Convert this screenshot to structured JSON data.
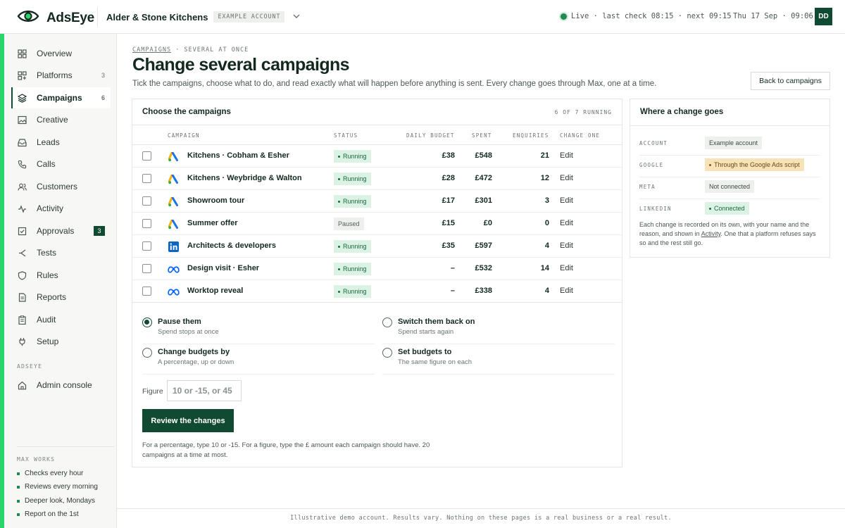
{
  "header": {
    "brand": "AdsEye",
    "account_name": "Alder & Stone Kitchens",
    "account_tag": "EXAMPLE ACCOUNT",
    "live_status": "Live · last check 08:15 · next 09:15",
    "datetime": "Thu 17 Sep · 09:06",
    "avatar_initials": "DD"
  },
  "sidebar": {
    "items": [
      {
        "label": "Overview",
        "icon": "grid-icon",
        "count": ""
      },
      {
        "label": "Platforms",
        "icon": "platforms-icon",
        "count": "3"
      },
      {
        "label": "Campaigns",
        "icon": "layers-icon",
        "count": "6",
        "active": true
      },
      {
        "label": "Creative",
        "icon": "image-icon",
        "count": ""
      },
      {
        "label": "Leads",
        "icon": "inbox-icon",
        "count": ""
      },
      {
        "label": "Calls",
        "icon": "phone-icon",
        "count": ""
      },
      {
        "label": "Customers",
        "icon": "users-icon",
        "count": ""
      },
      {
        "label": "Activity",
        "icon": "activity-icon",
        "count": ""
      },
      {
        "label": "Approvals",
        "icon": "checkbox-icon",
        "count": "3"
      },
      {
        "label": "Tests",
        "icon": "split-icon",
        "count": ""
      },
      {
        "label": "Rules",
        "icon": "shield-icon",
        "count": ""
      },
      {
        "label": "Reports",
        "icon": "document-icon",
        "count": ""
      },
      {
        "label": "Audit",
        "icon": "clipboard-icon",
        "count": ""
      },
      {
        "label": "Setup",
        "icon": "plug-icon",
        "count": ""
      }
    ],
    "section_label": "ADSEYE",
    "admin_label": "Admin console",
    "works_label": "MAX WORKS",
    "works": [
      "Checks every hour",
      "Reviews every morning",
      "Deeper look, Mondays",
      "Report on the 1st"
    ]
  },
  "page": {
    "breadcrumb_link": "CAMPAIGNS",
    "breadcrumb_rest": "· SEVERAL AT ONCE",
    "title": "Change several campaigns",
    "subtitle": "Tick the campaigns, choose what to do, and read exactly what will happen before anything is sent. Every change goes through Max, one at a time.",
    "back_button": "Back to campaigns"
  },
  "campaigns_panel": {
    "title": "Choose the campaigns",
    "meta": "6 OF 7 RUNNING",
    "columns": [
      "CAMPAIGN",
      "STATUS",
      "DAILY BUDGET",
      "SPENT",
      "ENQUIRIES",
      "CHANGE ONE"
    ],
    "rows": [
      {
        "platform": "google",
        "name": "Kitchens · Cobham & Esher",
        "status": "Running",
        "running": true,
        "budget": "£38",
        "spent": "£548",
        "enquiries": "21",
        "action": "Edit"
      },
      {
        "platform": "google",
        "name": "Kitchens · Weybridge & Walton",
        "status": "Running",
        "running": true,
        "budget": "£28",
        "spent": "£472",
        "enquiries": "12",
        "action": "Edit"
      },
      {
        "platform": "google",
        "name": "Showroom tour",
        "status": "Running",
        "running": true,
        "budget": "£17",
        "spent": "£301",
        "enquiries": "3",
        "action": "Edit"
      },
      {
        "platform": "google",
        "name": "Summer offer",
        "status": "Paused",
        "running": false,
        "budget": "£15",
        "spent": "£0",
        "enquiries": "0",
        "action": "Edit"
      },
      {
        "platform": "linkedin",
        "name": "Architects & developers",
        "status": "Running",
        "running": true,
        "budget": "£35",
        "spent": "£597",
        "enquiries": "4",
        "action": "Edit"
      },
      {
        "platform": "meta",
        "name": "Design visit · Esher",
        "status": "Running",
        "running": true,
        "budget": "–",
        "spent": "£532",
        "enquiries": "14",
        "action": "Edit"
      },
      {
        "platform": "meta",
        "name": "Worktop reveal",
        "status": "Running",
        "running": true,
        "budget": "–",
        "spent": "£338",
        "enquiries": "4",
        "action": "Edit"
      }
    ],
    "actions": [
      {
        "title": "Pause them",
        "sub": "Spend stops at once",
        "selected": true
      },
      {
        "title": "Switch them back on",
        "sub": "Spend starts again",
        "selected": false
      },
      {
        "title": "Change budgets by",
        "sub": "A percentage, up or down",
        "selected": false
      },
      {
        "title": "Set budgets to",
        "sub": "The same figure on each",
        "selected": false
      }
    ],
    "figure_label": "Figure",
    "figure_placeholder": "10 or -15, or 45",
    "review_button": "Review the changes",
    "help_text": "For a percentage, type 10 or -15. For a figure, type the £ amount each campaign should have. 20 campaigns at a time at most."
  },
  "routing_panel": {
    "title": "Where a change goes",
    "rows": [
      {
        "key": "ACCOUNT",
        "value": "Example account",
        "style": "grey"
      },
      {
        "key": "GOOGLE",
        "value": "Through the Google Ads script",
        "style": "amber"
      },
      {
        "key": "META",
        "value": "Not connected",
        "style": "grey"
      },
      {
        "key": "LINKEDIN",
        "value": "Connected",
        "style": "green"
      }
    ],
    "note_before": "Each change is recorded on its own, with your name and the reason, and shown in",
    "note_link": "Activity",
    "note_after": ". One that a platform refuses says so and the rest still go."
  },
  "footer": "Illustrative demo account. Results vary. Nothing on these pages is a real business or a real result.",
  "colors": {
    "brand_dark": "#114a33",
    "accent_green": "#2bd36b",
    "running_bg": "#dcf2e4",
    "amber_bg": "#f8e2b8"
  }
}
